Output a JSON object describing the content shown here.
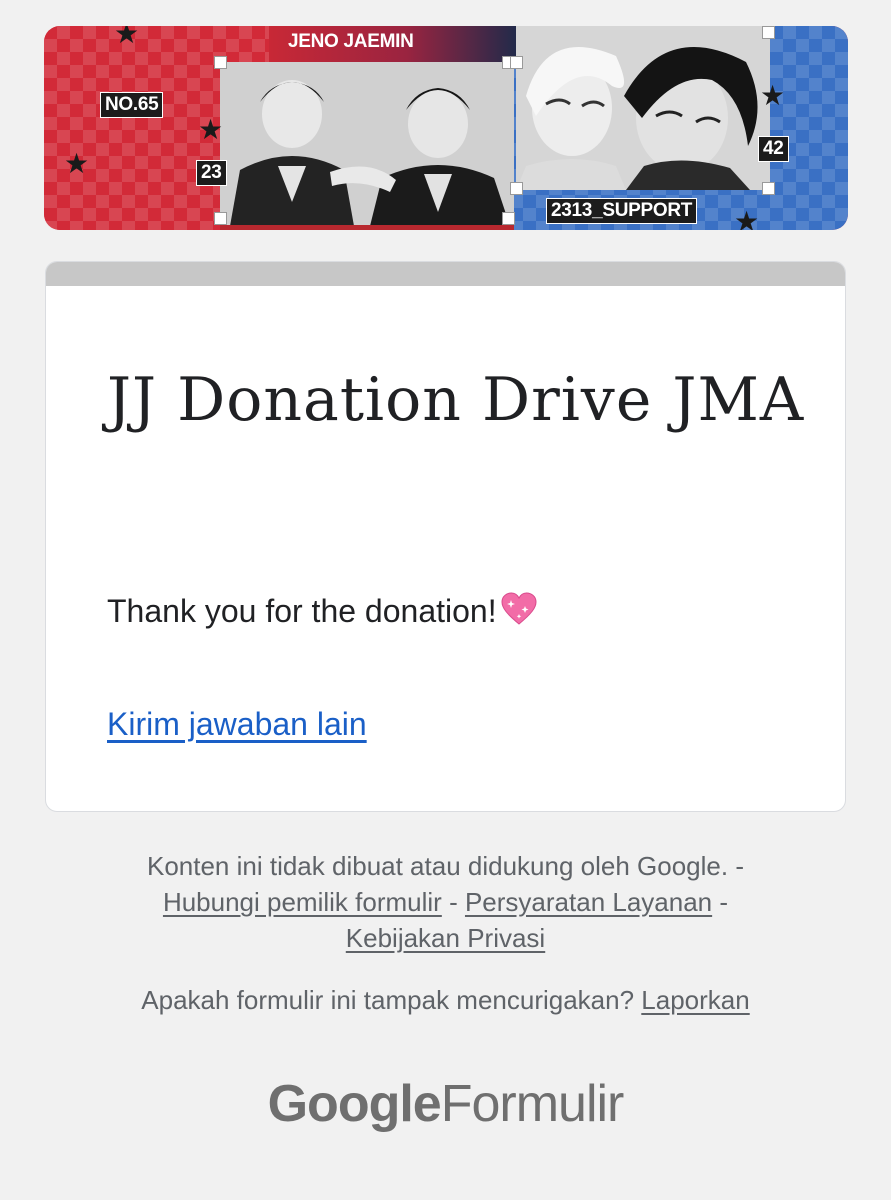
{
  "banner": {
    "title_tag": "JENO JAEMIN",
    "number_tag": "NO.65",
    "left_number": "23",
    "right_number": "42",
    "support_tag": "2313_SUPPORT",
    "colors": {
      "left": "#d22a38",
      "right": "#3a70c4"
    }
  },
  "form": {
    "title": "JJ Donation Drive JMA",
    "confirmation": "Thank you for the donation!",
    "confirmation_emoji": "sparkling-heart-icon",
    "another_response_link": "Kirim jawaban lain",
    "link_color": "#1a5fc7"
  },
  "footer": {
    "disclaimer": "Konten ini tidak dibuat atau didukung oleh Google.",
    "separator": "-",
    "contact_owner": "Hubungi pemilik formulir",
    "terms": "Persyaratan Layanan",
    "privacy": "Kebijakan Privasi",
    "report_question": "Apakah formulir ini tampak mencurigakan?",
    "report_link": "Laporkan"
  },
  "brand": {
    "google": "Google",
    "product": "Formulir"
  }
}
